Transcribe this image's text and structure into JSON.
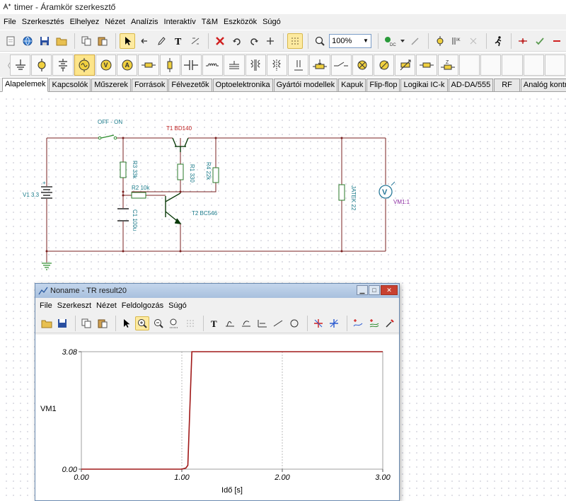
{
  "app": {
    "title": "timer - Áramkör szerkesztő"
  },
  "menu": [
    "File",
    "Szerkesztés",
    "Elhelyez",
    "Nézet",
    "Analízis",
    "Interaktív",
    "T&M",
    "Eszközök",
    "Súgó"
  ],
  "toolbar": {
    "zoom": "100%"
  },
  "component_tabs": [
    "Alapelemek",
    "Kapcsolók",
    "Műszerek",
    "Források",
    "Félvezetők",
    "Optoelektronika",
    "Gyártói modellek",
    "Kapuk",
    "Flip-flop",
    "Logikai IC-k",
    "AD-DA/555",
    "RF",
    "Analóg kontroll"
  ],
  "schematic": {
    "switch_label": "OFF - ON",
    "t1_label": "T1 BD140",
    "r3_label": "R3 33k",
    "r1_label": "R1 330",
    "r4_label": "R4 22k",
    "r2_label": "R2 10k",
    "v1_label": "V1 3.3",
    "c1_label": "C1 100u",
    "t2_label": "T2 BC546",
    "jatek_label": "JATEK 22",
    "vm_label": "VM1:1",
    "vm_symbol": "V",
    "v1_plus": "+"
  },
  "result_window": {
    "title": "Noname - TR result20",
    "menu": [
      "File",
      "Szerkeszt",
      "Nézet",
      "Feldolgozás",
      "Súgó"
    ]
  },
  "chart_data": {
    "type": "line",
    "series": [
      {
        "name": "VM1",
        "x": [
          0.0,
          1.0,
          1.04,
          1.06,
          1.1,
          3.0
        ],
        "y": [
          0.0,
          0.0,
          0.03,
          0.1,
          3.08,
          3.08
        ]
      }
    ],
    "xlabel": "Idő [s]",
    "ylabel": "VM1",
    "xlim": [
      0.0,
      3.0
    ],
    "ylim": [
      0.0,
      3.08
    ],
    "xticks": [
      "0.00",
      "1.00",
      "2.00",
      "3.00"
    ],
    "yticks": [
      "0.00",
      "3.08"
    ],
    "line_color": "#a01818",
    "grid": true
  }
}
